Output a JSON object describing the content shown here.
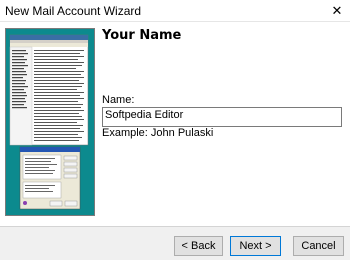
{
  "window": {
    "title": "New Mail Account Wizard",
    "close_glyph": "✕"
  },
  "page": {
    "heading": "Your Name",
    "name_label": "Name:",
    "name_value": "Softpedia Editor",
    "example_text": "Example: John Pulaski"
  },
  "buttons": {
    "back": "< Back",
    "next": "Next >",
    "cancel": "Cancel"
  },
  "colors": {
    "image_background": "#0c8a8e",
    "footer_background": "#f0f0f0"
  }
}
